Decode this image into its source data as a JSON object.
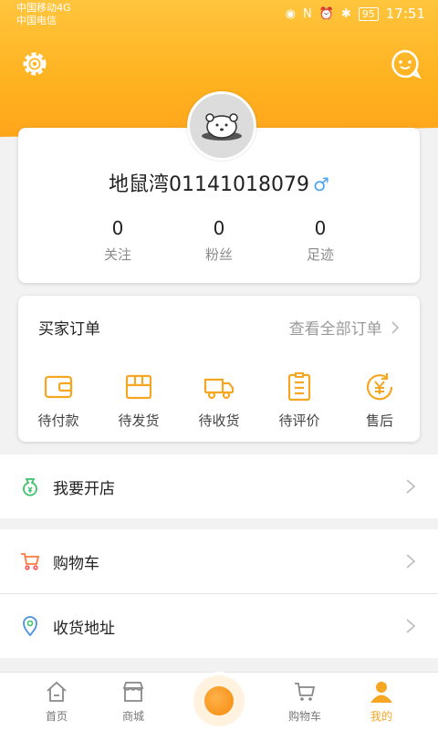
{
  "status_bar": {
    "carrier1": "中国移动4G",
    "carrier2": "中国电信",
    "battery": "95",
    "time": "17:51"
  },
  "profile": {
    "username": "地鼠湾01141018079",
    "gender_symbol": "♂",
    "stats": [
      {
        "value": "0",
        "label": "关注"
      },
      {
        "value": "0",
        "label": "粉丝"
      },
      {
        "value": "0",
        "label": "足迹"
      }
    ]
  },
  "orders": {
    "title": "买家订单",
    "view_all": "查看全部订单",
    "items": [
      {
        "label": "待付款",
        "icon": "wallet-icon"
      },
      {
        "label": "待发货",
        "icon": "package-icon"
      },
      {
        "label": "待收货",
        "icon": "truck-icon"
      },
      {
        "label": "待评价",
        "icon": "review-icon"
      },
      {
        "label": "售后",
        "icon": "after-sales-icon"
      }
    ]
  },
  "menu": {
    "open_shop": "我要开店",
    "cart": "购物车",
    "address": "收货地址"
  },
  "tabbar": {
    "home": "首页",
    "mall": "商城",
    "cart": "购物车",
    "mine": "我的"
  },
  "colors": {
    "accent": "#f5a623",
    "header_top": "#ffc53d",
    "header_bottom": "#ffa51c"
  }
}
